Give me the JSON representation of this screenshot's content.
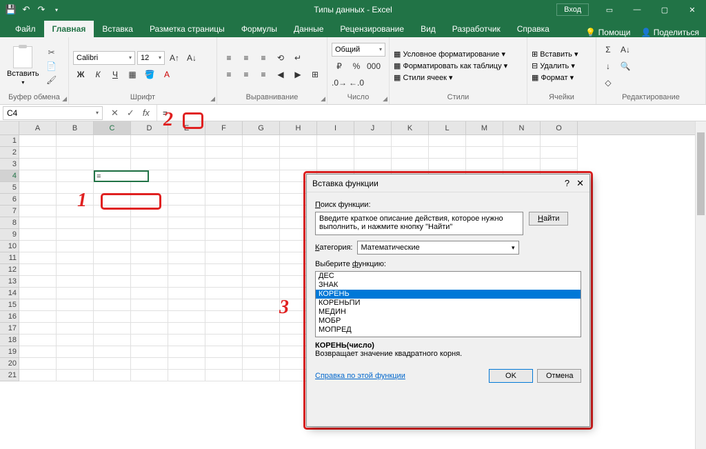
{
  "titlebar": {
    "title": "Типы данных  -  Excel",
    "login": "Вход"
  },
  "tabs": {
    "file": "Файл",
    "home": "Главная",
    "insert": "Вставка",
    "pagelayout": "Разметка страницы",
    "formulas": "Формулы",
    "data": "Данные",
    "review": "Рецензирование",
    "view": "Вид",
    "developer": "Разработчик",
    "help": "Справка",
    "tellme": "Помощи",
    "share": "Поделиться"
  },
  "ribbon": {
    "clipboard": {
      "paste": "Вставить",
      "label": "Буфер обмена"
    },
    "font": {
      "name": "Calibri",
      "size": "12",
      "label": "Шрифт",
      "bold": "Ж",
      "italic": "К",
      "underline": "Ч"
    },
    "align": {
      "label": "Выравнивание"
    },
    "number": {
      "format": "Общий",
      "label": "Число"
    },
    "styles": {
      "cond": "Условное форматирование",
      "table": "Форматировать как таблицу",
      "cell": "Стили ячеек",
      "label": "Стили"
    },
    "cells": {
      "insert": "Вставить",
      "delete": "Удалить",
      "format": "Формат",
      "label": "Ячейки"
    },
    "editing": {
      "label": "Редактирование"
    }
  },
  "namebox": {
    "ref": "C4"
  },
  "formula": {
    "text": "="
  },
  "active_cell": {
    "text": "="
  },
  "columns": [
    "A",
    "B",
    "C",
    "D",
    "E",
    "F",
    "G",
    "H",
    "I",
    "J",
    "K",
    "L",
    "M",
    "N",
    "O"
  ],
  "rows": [
    "1",
    "2",
    "3",
    "4",
    "5",
    "6",
    "7",
    "8",
    "9",
    "10",
    "11",
    "12",
    "13",
    "14",
    "15",
    "16",
    "17",
    "18",
    "19",
    "20",
    "21"
  ],
  "callouts": {
    "one": "1",
    "two": "2",
    "three": "3"
  },
  "dialog": {
    "title": "Вставка функции",
    "search_label": "Поиск функции:",
    "search_text": "Введите краткое описание действия, которое нужно выполнить, и нажмите кнопку \"Найти\"",
    "find": "Найти",
    "category_label": "Категория:",
    "category_value": "Математические",
    "select_label": "Выберите функцию:",
    "functions": [
      "ДЕС",
      "ЗНАК",
      "КОРЕНЬ",
      "КОРЕНЬПИ",
      "МЕДИН",
      "МОБР",
      "МОПРЕД"
    ],
    "selected_index": 2,
    "syntax": "КОРЕНЬ(число)",
    "description": "Возвращает значение квадратного корня.",
    "help_link": "Справка по этой функции",
    "ok": "OK",
    "cancel": "Отмена"
  }
}
